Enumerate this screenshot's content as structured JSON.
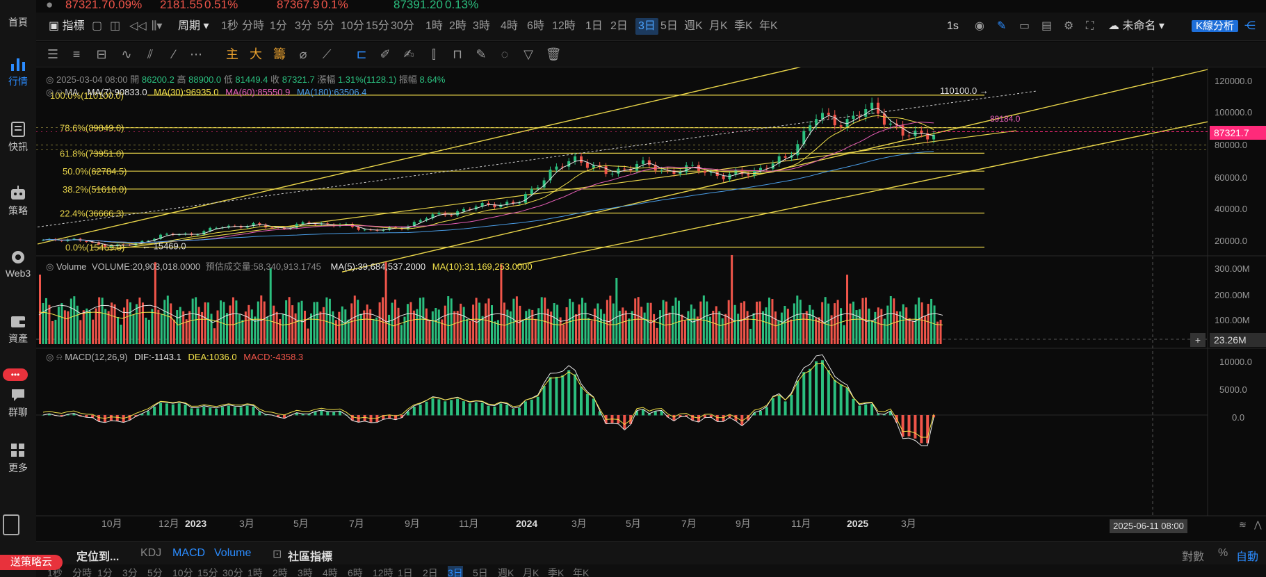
{
  "ticker": [
    {
      "text": "87321.7",
      "color": "#f0554a"
    },
    {
      "text": "0.09%",
      "color": "#f0554a"
    },
    {
      "text": "2181.55",
      "color": "#f0554a"
    },
    {
      "text": "0.51%",
      "color": "#f0554a"
    },
    {
      "text": "87367.9",
      "color": "#f0554a"
    },
    {
      "text": "0.1%",
      "color": "#f0554a"
    },
    {
      "text": "87391.20",
      "color": "#2bbf7f"
    },
    {
      "text": "0.13%",
      "color": "#2bbf7f"
    }
  ],
  "sidebar": {
    "items": [
      {
        "label": "首頁",
        "icon": "home-icon"
      },
      {
        "label": "行情",
        "icon": "market-chart-icon",
        "active": true
      },
      {
        "label": "快訊",
        "icon": "news-icon"
      },
      {
        "label": "策略",
        "icon": "robot-icon"
      },
      {
        "label": "Web3",
        "icon": "web3-icon"
      },
      {
        "label": "資產",
        "icon": "wallet-icon"
      },
      {
        "label": "群聊",
        "icon": "chat-icon"
      },
      {
        "label": "更多",
        "icon": "more-apps-icon"
      }
    ],
    "chat_badge": "•••",
    "promo_label": "送策略云"
  },
  "toolbar1": {
    "indicator_label": "指標",
    "period_label": "周期",
    "periods": [
      "1秒",
      "分時",
      "1分",
      "3分",
      "5分",
      "10分",
      "15分",
      "30分",
      "1時",
      "2時",
      "3時",
      "4時",
      "6時",
      "12時",
      "1日",
      "2日",
      "3日",
      "5日",
      "週K",
      "月K",
      "季K",
      "年K"
    ],
    "active_period": "3日",
    "interval": "1s",
    "layout_name": "未命名",
    "analysis_button": "K線分析"
  },
  "toolbar2": {
    "main_label": "主",
    "big_label": "大",
    "chip_label": "籌"
  },
  "ohlc": {
    "date": "2025-03-04 08:00",
    "open_label": "開",
    "open": "86200.2",
    "high_label": "高",
    "high": "88900.0",
    "low_label": "低",
    "low": "81449.4",
    "close_label": "收",
    "close": "87321.7",
    "change_label": "漲幅",
    "change": "1.31%(1128.1)",
    "amplitude_label": "振幅",
    "amplitude": "8.64%"
  },
  "ma": {
    "label": "MA",
    "ma7": "MA(7):90833.0",
    "ma30": "MA(30):96935.0",
    "ma60": "MA(60):85550.9",
    "ma180": "MA(180):63506.4",
    "colors": {
      "ma7": "#e8e8e8",
      "ma30": "#f3e24a",
      "ma60": "#e75fb8",
      "ma180": "#4a9de6"
    }
  },
  "fib": [
    {
      "label": "100.0%(110100.0)",
      "value": 110100
    },
    {
      "label": "78.6%(89849.0)",
      "value": 89849
    },
    {
      "label": "61.8%(73951.0)",
      "value": 73951
    },
    {
      "label": "50.0%(62784.5)",
      "value": 62784.5
    },
    {
      "label": "38.2%(51618.0)",
      "value": 51618
    },
    {
      "label": "22.4%(36666.3)",
      "value": 36666.3
    },
    {
      "label": "0.0%(15469.0)",
      "value": 15469
    }
  ],
  "annotations": {
    "high_mark": "110100.0",
    "low_mark": "15469.0",
    "mid_mark": "89184.0"
  },
  "price_axis": [
    "120000.0",
    "100000.0",
    "80000.0",
    "60000.0",
    "40000.0",
    "20000.0"
  ],
  "current_price": "87321.7",
  "volume": {
    "label": "Volume",
    "volume": "VOLUME:20,903,018.0000",
    "est": "預估成交量:58,340,913.1745",
    "ma5": "MA(5):39,684,537.2000",
    "ma10": "MA(10):31,169,253.0000",
    "axis": [
      "300.00M",
      "200.00M",
      "100.00M"
    ],
    "crosshair_value": "23.26M"
  },
  "macd": {
    "label": "MACD(12,26,9)",
    "dif": "DIF:-1143.1",
    "dea": "DEA:1036.0",
    "macd": "MACD:-4358.3",
    "axis": [
      "10000.0",
      "5000.0",
      "0.0"
    ]
  },
  "time_axis": [
    "10月",
    "12月",
    "2023",
    "3月",
    "5月",
    "7月",
    "9月",
    "11月",
    "2024",
    "3月",
    "5月",
    "7月",
    "9月",
    "11月",
    "2025",
    "3月"
  ],
  "crosshair_time": "2025-06-11 08:00",
  "bottombar": {
    "locate": "定位到...",
    "indicators": [
      "KDJ",
      "MACD",
      "Volume"
    ],
    "community": "社區指標",
    "right": [
      "對數",
      "%",
      "自動"
    ]
  },
  "period_strip": [
    "1秒",
    "分時",
    "1分",
    "3分",
    "5分",
    "10分",
    "15分",
    "30分",
    "1時",
    "2時",
    "3時",
    "4時",
    "6時",
    "12時",
    "1日",
    "2日",
    "3日",
    "5日",
    "週K",
    "月K",
    "季K",
    "年K"
  ],
  "chart_data": {
    "type": "candlestick",
    "price_range": [
      10000,
      125000
    ],
    "close_series": [
      {
        "date": "2022-09",
        "close": 19500
      },
      {
        "date": "2022-10",
        "close": 20500
      },
      {
        "date": "2022-11",
        "close": 16500
      },
      {
        "date": "2022-12",
        "close": 16800
      },
      {
        "date": "2023-01",
        "close": 23000
      },
      {
        "date": "2023-02",
        "close": 23500
      },
      {
        "date": "2023-03",
        "close": 28000
      },
      {
        "date": "2023-04",
        "close": 29300
      },
      {
        "date": "2023-05",
        "close": 27200
      },
      {
        "date": "2023-06",
        "close": 30500
      },
      {
        "date": "2023-07",
        "close": 29200
      },
      {
        "date": "2023-08",
        "close": 26000
      },
      {
        "date": "2023-09",
        "close": 27000
      },
      {
        "date": "2023-10",
        "close": 34500
      },
      {
        "date": "2023-11",
        "close": 37700
      },
      {
        "date": "2023-12",
        "close": 42300
      },
      {
        "date": "2024-01",
        "close": 42600
      },
      {
        "date": "2024-02",
        "close": 61200
      },
      {
        "date": "2024-03",
        "close": 71300
      },
      {
        "date": "2024-04",
        "close": 60700
      },
      {
        "date": "2024-05",
        "close": 67500
      },
      {
        "date": "2024-06",
        "close": 62700
      },
      {
        "date": "2024-07",
        "close": 64600
      },
      {
        "date": "2024-08",
        "close": 59000
      },
      {
        "date": "2024-09",
        "close": 63300
      },
      {
        "date": "2024-10",
        "close": 70200
      },
      {
        "date": "2024-11",
        "close": 96400
      },
      {
        "date": "2024-12",
        "close": 93400
      },
      {
        "date": "2025-01",
        "close": 102400
      },
      {
        "date": "2025-02",
        "close": 84300
      },
      {
        "date": "2025-03",
        "close": 87321.7
      }
    ]
  }
}
